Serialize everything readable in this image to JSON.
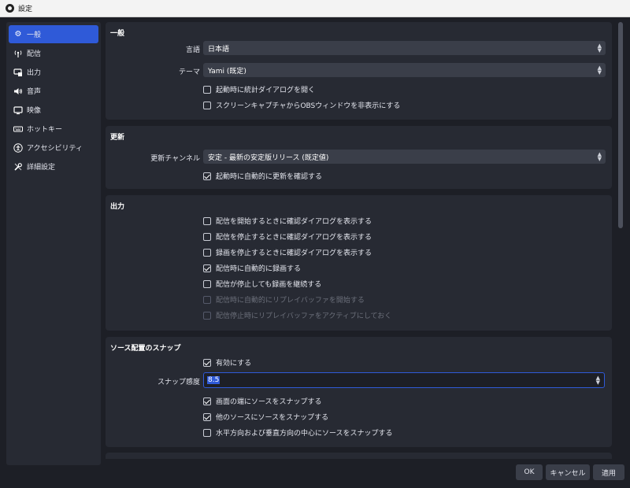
{
  "window": {
    "title": "設定"
  },
  "sidebar": {
    "items": [
      {
        "label": "一般",
        "icon": "gear-icon",
        "active": true
      },
      {
        "label": "配信",
        "icon": "broadcast-icon"
      },
      {
        "label": "出力",
        "icon": "output-icon"
      },
      {
        "label": "音声",
        "icon": "speaker-icon"
      },
      {
        "label": "映像",
        "icon": "monitor-icon"
      },
      {
        "label": "ホットキー",
        "icon": "keyboard-icon"
      },
      {
        "label": "アクセシビリティ",
        "icon": "accessibility-icon"
      },
      {
        "label": "詳細設定",
        "icon": "wrench-icon"
      }
    ]
  },
  "general": {
    "title": "一般",
    "language_label": "言語",
    "language_value": "日本語",
    "theme_label": "テーマ",
    "theme_value": "Yami (既定)",
    "check1": "起動時に統計ダイアログを開く",
    "check2": "スクリーンキャプチャからOBSウィンドウを非表示にする"
  },
  "update": {
    "title": "更新",
    "channel_label": "更新チャンネル",
    "channel_value": "安定 - 最新の安定版リリース (既定値)",
    "check1": "起動時に自動的に更新を確認する"
  },
  "output": {
    "title": "出力",
    "check1": "配信を開始するときに確認ダイアログを表示する",
    "check2": "配信を停止するときに確認ダイアログを表示する",
    "check3": "録画を停止するときに確認ダイアログを表示する",
    "check4": "配信時に自動的に録画する",
    "check5": "配信が停止しても録画を継続する",
    "check6": "配信時に自動的にリプレイバッファを開始する",
    "check7": "配信停止時にリプレイバッファをアクティブにしておく"
  },
  "snap": {
    "title": "ソース配置のスナップ",
    "enable": "有効にする",
    "sensitivity_label": "スナップ感度",
    "sensitivity_value": "8.5",
    "check1": "画面の端にソースをスナップする",
    "check2": "他のソースにソースをスナップする",
    "check3": "水平方向および垂直方向の中心にソースをスナップする"
  },
  "footer": {
    "ok": "OK",
    "cancel": "キャンセル",
    "apply": "適用"
  },
  "colors": {
    "accent": "#2f5ad8",
    "panel": "#272a33",
    "background": "#1d1f26",
    "field": "#3a3e49"
  }
}
